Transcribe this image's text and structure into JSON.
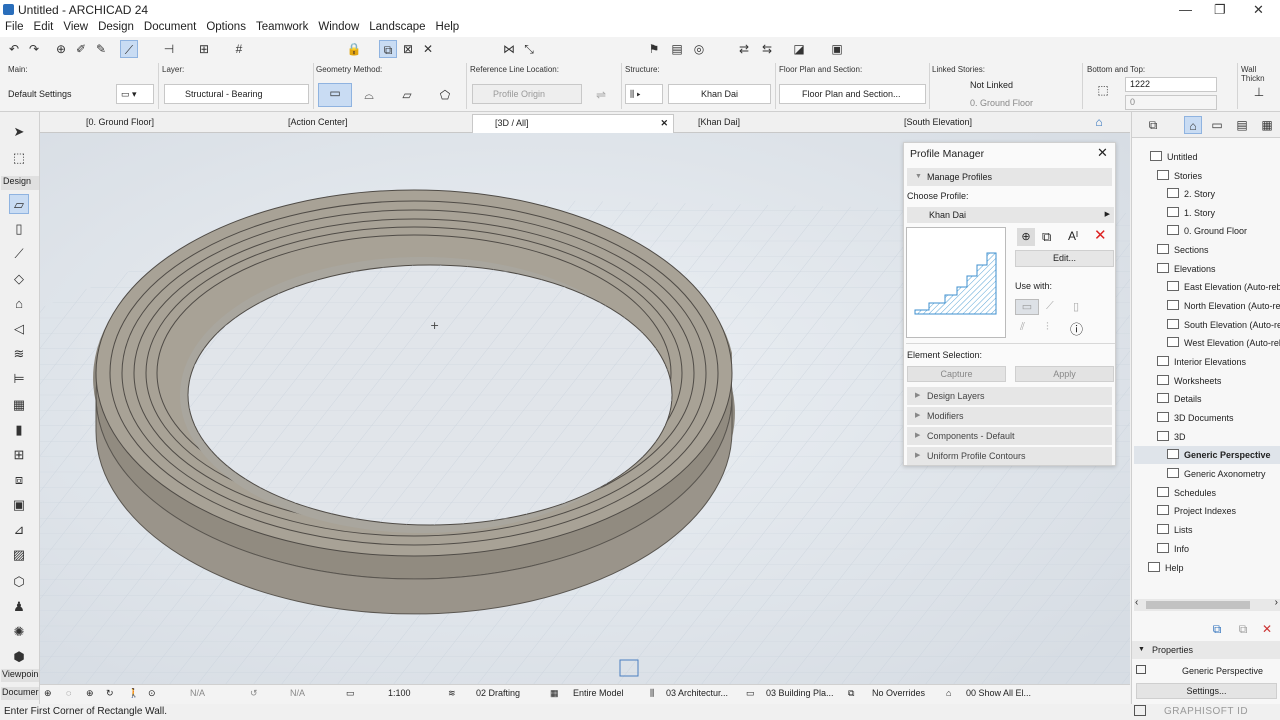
{
  "window": {
    "title": "Untitled - ARCHICAD 24"
  },
  "menu": [
    "File",
    "Edit",
    "View",
    "Design",
    "Document",
    "Options",
    "Teamwork",
    "Window",
    "Landscape",
    "Help"
  ],
  "info_box": {
    "main": {
      "label": "Main:",
      "value": "Default Settings"
    },
    "layer": {
      "label": "Layer:",
      "value": "Structural - Bearing"
    },
    "geometry": {
      "label": "Geometry Method:"
    },
    "ref_line": {
      "label": "Reference Line Location:",
      "value": "Profile Origin"
    },
    "structure": {
      "label": "Structure:",
      "value": "Khan Dai"
    },
    "floor_plan": {
      "label": "Floor Plan and Section:",
      "value": "Floor Plan and Section..."
    },
    "linked": {
      "label": "Linked Stories:",
      "value1": "Not Linked",
      "value2": "0. Ground Floor"
    },
    "bottom_top": {
      "label": "Bottom and Top:",
      "value1": "1222",
      "value2": "0"
    },
    "wall_thick": {
      "label": "Wall Thickn"
    }
  },
  "tabs": [
    {
      "label": "[0. Ground Floor]"
    },
    {
      "label": "[Action Center]"
    },
    {
      "label": "[3D / All]"
    },
    {
      "label": "[Khan Dai]"
    },
    {
      "label": "[South Elevation]"
    }
  ],
  "toolbox": {
    "design_label": "Design",
    "viewpoint_label": "Viewpoin",
    "document_label": "Documer"
  },
  "profile_manager": {
    "title": "Profile Manager",
    "section": "Manage Profiles",
    "choose_label": "Choose Profile:",
    "profile": "Khan Dai",
    "edit": "Edit...",
    "use_with": "Use with:",
    "element_selection": "Element Selection:",
    "capture": "Capture",
    "apply": "Apply",
    "panels": [
      "Design Layers",
      "Modifiers",
      "Components - Default",
      "Uniform Profile Contours"
    ]
  },
  "navigator": {
    "items": [
      {
        "label": "Untitled"
      },
      {
        "label": "Stories"
      },
      {
        "label": "2. Story"
      },
      {
        "label": "1. Story"
      },
      {
        "label": "0. Ground Floor"
      },
      {
        "label": "Sections"
      },
      {
        "label": "Elevations"
      },
      {
        "label": "East Elevation (Auto-rebu"
      },
      {
        "label": "North Elevation (Auto-rel"
      },
      {
        "label": "South Elevation (Auto-rel"
      },
      {
        "label": "West Elevation (Auto-reb"
      },
      {
        "label": "Interior Elevations"
      },
      {
        "label": "Worksheets"
      },
      {
        "label": "Details"
      },
      {
        "label": "3D Documents"
      },
      {
        "label": "3D"
      },
      {
        "label": "Generic Perspective"
      },
      {
        "label": "Generic Axonometry"
      },
      {
        "label": "Schedules"
      },
      {
        "label": "Project Indexes"
      },
      {
        "label": "Lists"
      },
      {
        "label": "Info"
      },
      {
        "label": "Help"
      }
    ],
    "properties_label": "Properties",
    "properties_value": "Generic Perspective",
    "settings": "Settings..."
  },
  "quick_options": {
    "na1": "N/A",
    "na2": "N/A",
    "scale": "1:100",
    "pen": "02 Drafting",
    "model": "Entire Model",
    "arch": "03 Architectur...",
    "plan": "03 Building Pla...",
    "override": "No Overrides",
    "show": "00 Show All El..."
  },
  "status": {
    "text": "Enter First Corner of Rectangle Wall.",
    "brand": "GRAPHISOFT ID"
  },
  "colors": {
    "accent": "#2a6ebb",
    "ring_top": "#a8a296",
    "ring_side": "#918b80",
    "grid_bg": "#e3e7ec"
  }
}
